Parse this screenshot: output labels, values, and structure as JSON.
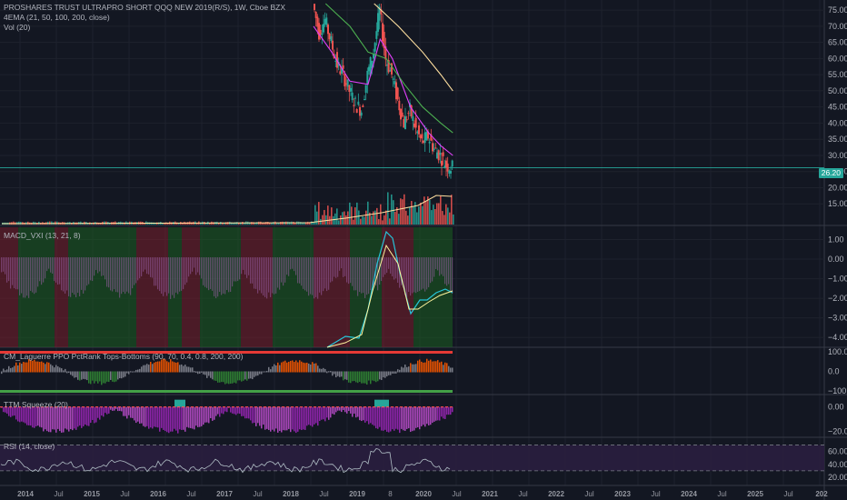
{
  "header": {
    "symbol_title": "PROSHARES TRUST ULTRAPRO SHORT QQQ NEW 2019(R/S), 1W, Cboe BZX",
    "indicator_ema": "4EMA (21, 50, 100, 200, close)",
    "indicator_vol": "Vol (20)"
  },
  "last_price": "26.20",
  "colors": {
    "background": "#131722",
    "up": "#26a69a",
    "down": "#ef5350",
    "ema21": "#e040fb",
    "ema50": "#4caf50",
    "ema200": "#ffe0a0",
    "purple_band": "#2a1e3f",
    "grid": "#1e222d"
  },
  "panes": {
    "price": {
      "ticks": [
        "75.00",
        "70.00",
        "65.00",
        "60.00",
        "55.00",
        "50.00",
        "45.00",
        "40.00",
        "35.00",
        "30.00",
        "25.00",
        "20.00",
        "15.00"
      ]
    },
    "macd": {
      "title": "MACD_VXI (13, 21, 8)",
      "ticks": [
        "1.00",
        "0.00",
        "−1.00",
        "−2.00",
        "−3.00",
        "−4.00"
      ]
    },
    "laguerre": {
      "title": "CM_Laguerre PPO PctRank Tops-Bottoms (90, 70, 0.4, 0.8, 200, 200)",
      "ticks": [
        "100.0",
        "0.0",
        "−100.0"
      ]
    },
    "ttm": {
      "title": "TTM Squeeze (20)",
      "ticks": [
        "0.00",
        "−20.00"
      ]
    },
    "rsi": {
      "title": "RSI (14, close)",
      "ticks": [
        "60.00",
        "40.00",
        "20.00"
      ]
    }
  },
  "time_axis": [
    "2014",
    "Jul",
    "2015",
    "Jul",
    "2016",
    "Jul",
    "2017",
    "Jul",
    "2018",
    "Jul",
    "2019",
    "8",
    "2020",
    "Jul",
    "2021",
    "Jul",
    "2022",
    "Jul",
    "2023",
    "Jul",
    "2024",
    "Jul",
    "2025",
    "Jul",
    "202"
  ],
  "chart_data": {
    "type": "candlestick",
    "title": "PROSHARES TRUST ULTRAPRO SHORT QQQ NEW 2019(R/S), 1W, Cboe BZX",
    "y_range": [
      10,
      77
    ],
    "last_close": 26.2,
    "price_path": [
      {
        "date": "2018-01",
        "value": 77
      },
      {
        "date": "2018-02",
        "value": 68
      },
      {
        "date": "2018-03",
        "value": 72
      },
      {
        "date": "2018-04",
        "value": 65
      },
      {
        "date": "2018-05",
        "value": 58
      },
      {
        "date": "2018-06",
        "value": 55
      },
      {
        "date": "2018-07",
        "value": 50
      },
      {
        "date": "2018-08",
        "value": 46
      },
      {
        "date": "2018-09",
        "value": 44
      },
      {
        "date": "2018-10",
        "value": 55
      },
      {
        "date": "2018-11",
        "value": 62
      },
      {
        "date": "2018-12",
        "value": 75
      },
      {
        "date": "2019-01",
        "value": 60
      },
      {
        "date": "2019-02",
        "value": 55
      },
      {
        "date": "2019-03",
        "value": 47
      },
      {
        "date": "2019-04",
        "value": 40
      },
      {
        "date": "2019-05",
        "value": 44
      },
      {
        "date": "2019-06",
        "value": 38
      },
      {
        "date": "2019-07",
        "value": 34
      },
      {
        "date": "2019-08",
        "value": 36
      },
      {
        "date": "2019-09",
        "value": 32
      },
      {
        "date": "2019-10",
        "value": 30
      },
      {
        "date": "2019-11",
        "value": 27
      },
      {
        "date": "2019-12",
        "value": 26.2
      }
    ]
  }
}
